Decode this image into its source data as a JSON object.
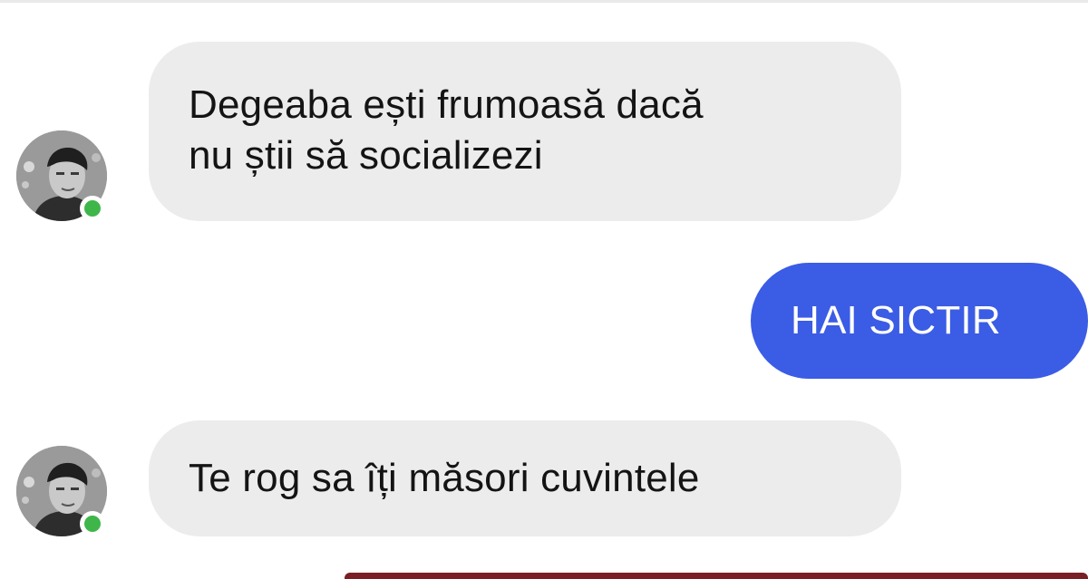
{
  "conversation": {
    "messages": [
      {
        "direction": "incoming",
        "lines": [
          "Degeaba ești frumoasă dacă",
          "nu știi să socializezi"
        ]
      },
      {
        "direction": "outgoing",
        "text": "HAI SICTIR"
      },
      {
        "direction": "incoming",
        "text": "Te rog sa îți măsori cuvintele"
      }
    ]
  },
  "avatar": {
    "online": true,
    "presence_color": "#3fb64a"
  },
  "colors": {
    "incoming_bubble": "#ececec",
    "outgoing_bubble": "#3b5ce5",
    "background": "#ffffff"
  }
}
